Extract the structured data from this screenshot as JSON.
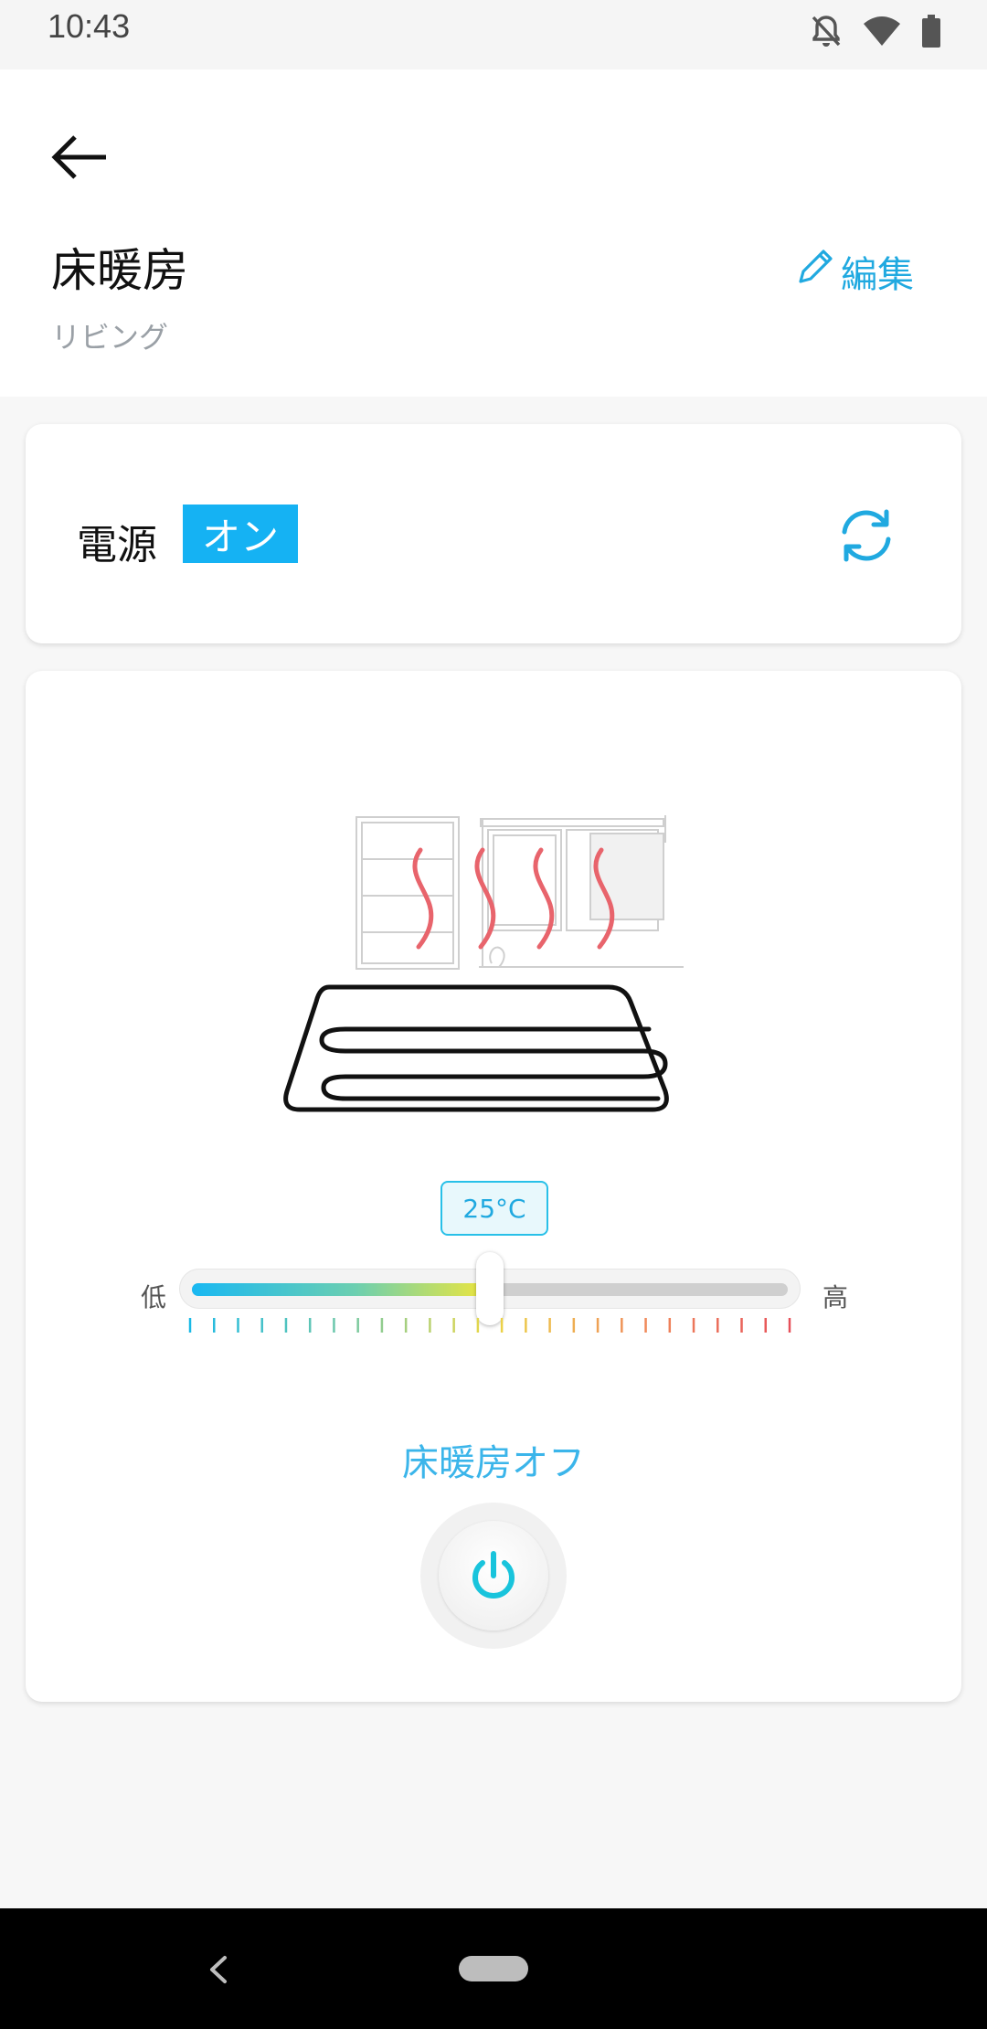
{
  "status_bar": {
    "time": "10:43",
    "icons": [
      "bell-off-icon",
      "wifi-icon",
      "battery-icon"
    ]
  },
  "header": {
    "title": "床暖房",
    "subtitle": "リビング",
    "edit_label": "編集",
    "icons": [
      "back-arrow-icon",
      "pencil-icon"
    ]
  },
  "power_card": {
    "label": "電源",
    "state": "オン",
    "icons": [
      "refresh-icon"
    ]
  },
  "control_card": {
    "temperature": "25°C",
    "low_label": "低",
    "high_label": "高",
    "mode_label": "床暖房オフ",
    "slider_level": 0.5,
    "icons": [
      "floor-heating-illustration",
      "power-icon"
    ]
  },
  "colors": {
    "accent": "#20a9e0",
    "badge": "#15b2f3",
    "heat_wave": "#e8646c",
    "power_icon": "#19c4dc"
  },
  "nav_bar": {
    "icons": [
      "nav-back-icon",
      "nav-home-pill"
    ]
  }
}
